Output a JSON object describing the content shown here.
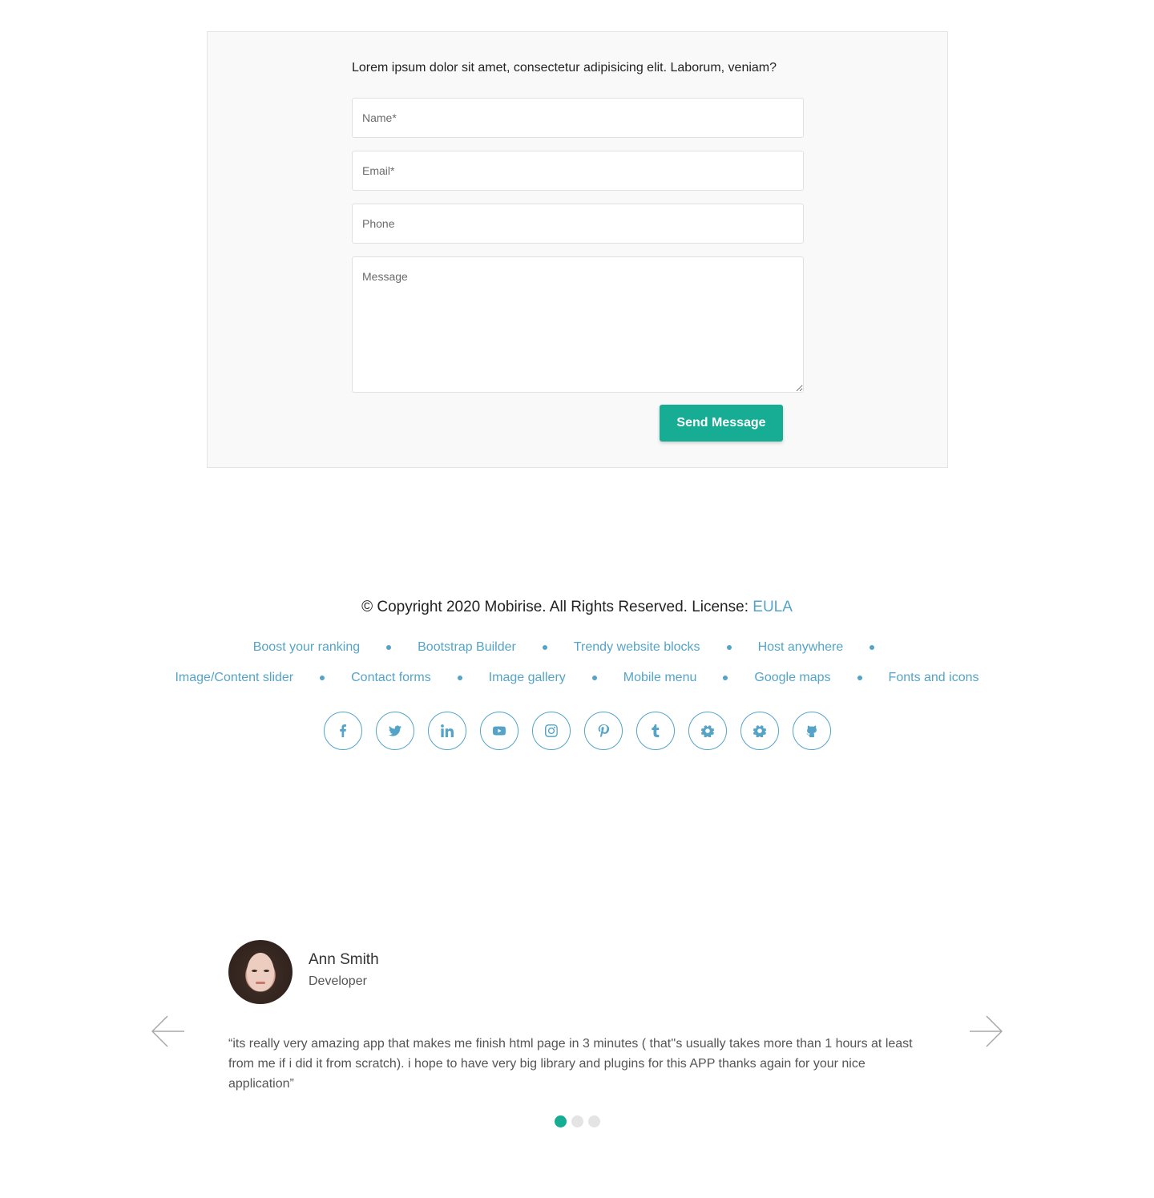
{
  "form": {
    "intro": "Lorem ipsum dolor sit amet, consectetur adipisicing elit. Laborum, veniam?",
    "name_placeholder": "Name*",
    "email_placeholder": "Email*",
    "phone_placeholder": "Phone",
    "message_placeholder": "Message",
    "submit_label": "Send Message"
  },
  "footer": {
    "copyright": "© Copyright 2020 Mobirise. All Rights Reserved. License: ",
    "license_link": "EULA",
    "links_row1": [
      "Boost your ranking",
      "Bootstrap Builder",
      "Trendy website blocks",
      "Host anywhere"
    ],
    "links_row2": [
      "Image/Content slider",
      "Contact forms",
      "Image gallery",
      "Mobile menu",
      "Google maps",
      "Fonts and icons"
    ],
    "social_icons": [
      "facebook-icon",
      "twitter-icon",
      "linkedin-icon",
      "youtube-icon",
      "instagram-icon",
      "pinterest-icon",
      "tumblr-icon",
      "gear-icon",
      "gear-icon",
      "github-icon"
    ]
  },
  "testimonial": {
    "name": "Ann Smith",
    "role": "Developer",
    "quote": "“its really very amazing app that makes me finish html page in 3 minutes ( that''s usually takes more than 1 hours at least from me if i did it from scratch). i hope to have very big library and plugins for this APP thanks again for your nice application”",
    "slide_count": 3,
    "active_slide": 1
  },
  "colors": {
    "accent": "#17ad94",
    "link": "#55a4c8",
    "card_bg": "#f9f9f9"
  }
}
